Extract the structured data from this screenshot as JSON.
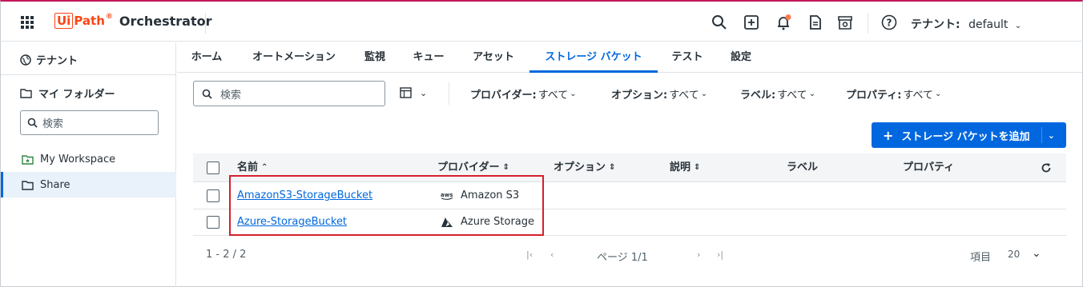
{
  "header": {
    "brand": "Ui",
    "brand_path": "Path",
    "brand_tm": "®",
    "product": "Orchestrator",
    "tenant_label": "テナント:",
    "tenant_value": "default",
    "accent_color": "#c2185b",
    "icons": [
      "apps-grid-icon",
      "search-icon",
      "add-box-icon",
      "bell-icon",
      "document-icon",
      "store-icon",
      "help-icon",
      "chevron-down-icon"
    ]
  },
  "sidebar": {
    "tenant": "テナント",
    "my_folders": "マイ フォルダー",
    "search_placeholder": "検索",
    "items": [
      {
        "label": "My Workspace",
        "icon": "workspace-folder-icon"
      },
      {
        "label": "Share",
        "icon": "folder-icon",
        "selected": true
      }
    ]
  },
  "tabs": [
    "ホーム",
    "オートメーション",
    "監視",
    "キュー",
    "アセット",
    "ストレージ バケット",
    "テスト",
    "設定"
  ],
  "active_tab": "ストレージ バケット",
  "toolbar": {
    "search_placeholder": "検索",
    "filters": [
      {
        "label": "プロバイダー:",
        "value": "すべて"
      },
      {
        "label": "オプション:",
        "value": "すべて"
      },
      {
        "label": "ラベル:",
        "value": "すべて"
      },
      {
        "label": "プロパティ:",
        "value": "すべて"
      }
    ],
    "add_button": "ストレージ バケットを追加",
    "add_plus": "+"
  },
  "table": {
    "columns": [
      {
        "label": "名前",
        "sort": "asc"
      },
      {
        "label": "プロバイダー",
        "sort": "both"
      },
      {
        "label": "オプション",
        "sort": "both"
      },
      {
        "label": "説明",
        "sort": "both"
      },
      {
        "label": "ラベル"
      },
      {
        "label": "プロパティ"
      }
    ],
    "rows": [
      {
        "name": "AmazonS3-StorageBucket",
        "provider": "Amazon S3",
        "provider_icon": "aws-icon"
      },
      {
        "name": "Azure-StorageBucket",
        "provider": "Azure Storage",
        "provider_icon": "azure-icon"
      }
    ]
  },
  "pagination": {
    "range": "1 - 2 / 2",
    "page": "ページ 1/1",
    "items_label": "項目",
    "page_size": "20"
  },
  "colors": {
    "primary": "#0067df",
    "highlight": "#d61f2b",
    "brand": "#fa4616"
  }
}
